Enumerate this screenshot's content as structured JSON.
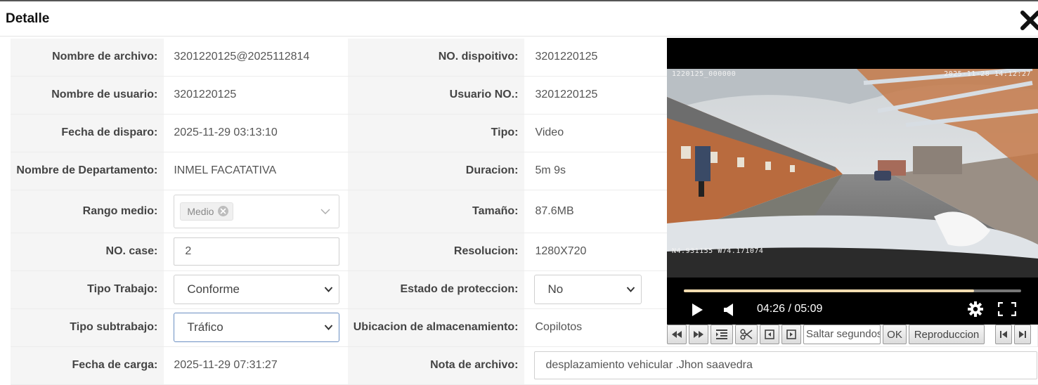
{
  "dialog": {
    "title": "Detalle",
    "close_icon": "close-x-icon"
  },
  "rows": [
    {
      "l1": "Nombre de archivo:",
      "v1": "3201220125@2025112814",
      "l2": "NO. dispoitivo:",
      "v2": "3201220125"
    },
    {
      "l1": "Nombre de usuario:",
      "v1": "3201220125",
      "l2": "Usuario NO.:",
      "v2": "3201220125"
    },
    {
      "l1": "Fecha de disparo:",
      "v1": "2025-11-29 03:13:10",
      "l2": "Tipo:",
      "v2": "Video"
    },
    {
      "l1": "Nombre de Departamento:",
      "v1": "INMEL FACATATIVA",
      "l2": "Duracion:",
      "v2": "5m 9s"
    },
    {
      "l1": "Rango medio:",
      "tag": "Medio",
      "l2": "Tamaño:",
      "v2": "87.6MB"
    },
    {
      "l1": "NO. case:",
      "input": "2",
      "l2": "Resolucion:",
      "v2": "1280X720"
    },
    {
      "l1": "Tipo Trabajo:",
      "select": "Conforme",
      "l2": "Estado de proteccion:",
      "select2": "No"
    },
    {
      "l1": "Tipo subtrabajo:",
      "select": "Tráfico",
      "l2": "Ubicacion de almacenamiento:",
      "v2": "Copilotos"
    },
    {
      "l1": "Fecha de carga:",
      "v1": "2025-11-29 07:31:27",
      "l2": "Nota de archivo:",
      "note": "desplazamiento vehicular .Jhon saavedra"
    }
  ],
  "video": {
    "osd_top_left": "1220125_000000",
    "osd_top_right": "2025-11-28  14:12:27",
    "osd_bottom_left": "N4.931155  W74.171074",
    "time": "04:26 / 05:09",
    "progress": 0.86
  },
  "toolbar": {
    "seek_placeholder": "Saltar segundos",
    "ok": "OK",
    "playback": "Reproduccion"
  }
}
